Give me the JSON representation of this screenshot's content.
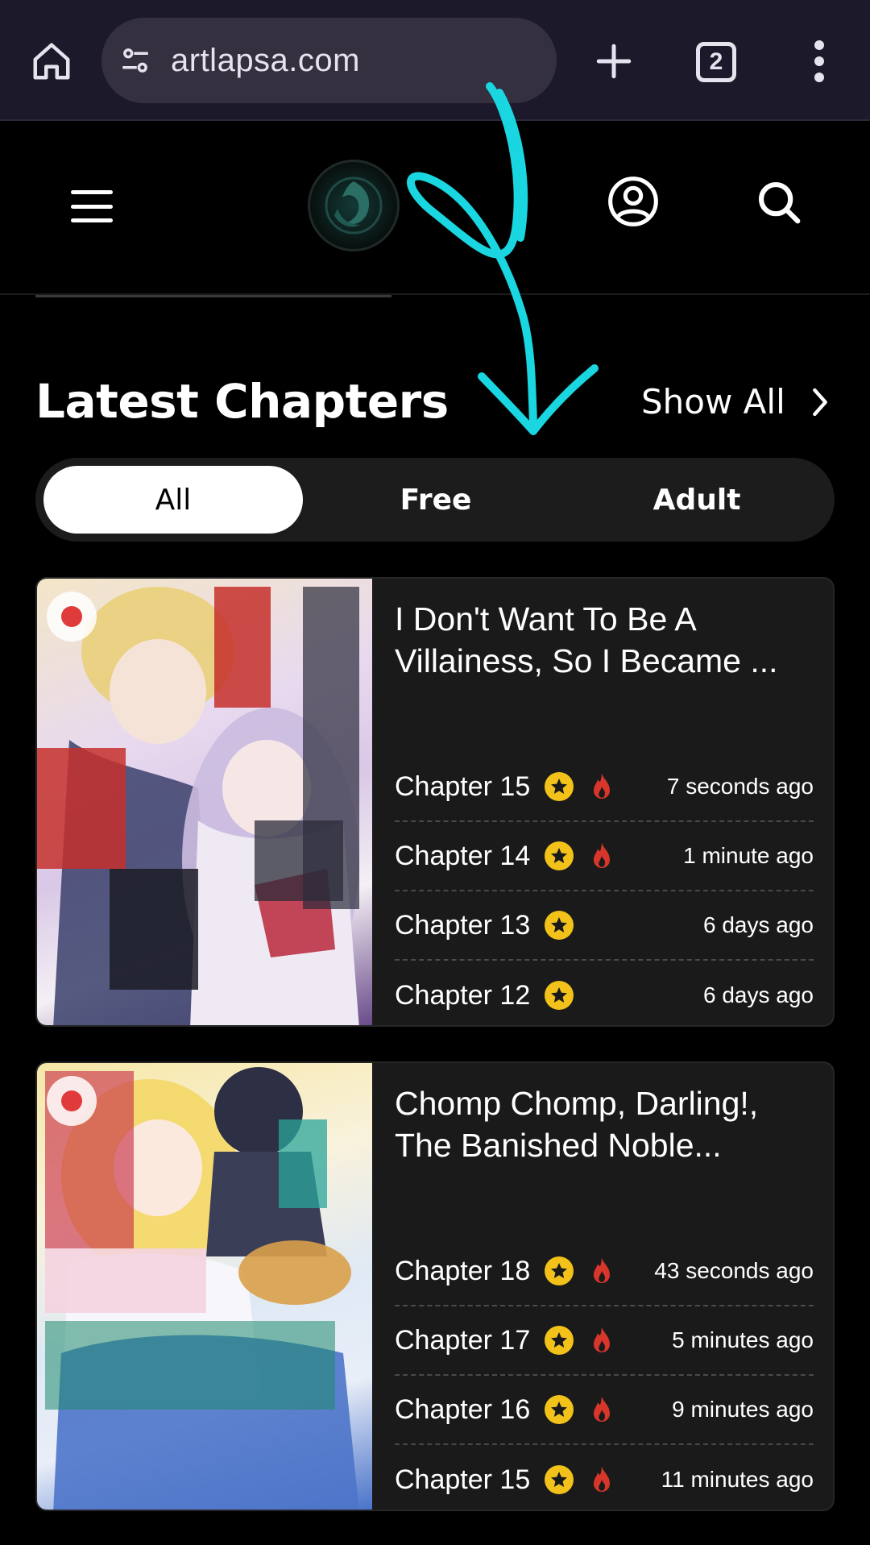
{
  "browser": {
    "url": "artlapsa.com",
    "tab_count": "2"
  },
  "section": {
    "title": "Latest Chapters",
    "show_all": "Show All"
  },
  "filters": {
    "tabs": [
      "All",
      "Free",
      "Adult"
    ],
    "active": "All"
  },
  "colors": {
    "star": "#f2c21b",
    "fire": "#d9362b",
    "annotation": "#19d6e0"
  },
  "cards": [
    {
      "title": "I Don't Want To Be A Villainess, So I Became ...",
      "chapters": [
        {
          "name": "Chapter 15",
          "time": "7 seconds ago",
          "star": true,
          "hot": true
        },
        {
          "name": "Chapter 14",
          "time": "1 minute ago",
          "star": true,
          "hot": true
        },
        {
          "name": "Chapter 13",
          "time": "6 days ago",
          "star": true,
          "hot": false
        },
        {
          "name": "Chapter 12",
          "time": "6 days ago",
          "star": true,
          "hot": false
        }
      ]
    },
    {
      "title": "Chomp Chomp, Darling!, The Banished Noble...",
      "chapters": [
        {
          "name": "Chapter 18",
          "time": "43 seconds ago",
          "star": true,
          "hot": true
        },
        {
          "name": "Chapter 17",
          "time": "5 minutes ago",
          "star": true,
          "hot": true
        },
        {
          "name": "Chapter 16",
          "time": "9 minutes ago",
          "star": true,
          "hot": true
        },
        {
          "name": "Chapter 15",
          "time": "11 minutes ago",
          "star": true,
          "hot": true
        }
      ]
    }
  ]
}
